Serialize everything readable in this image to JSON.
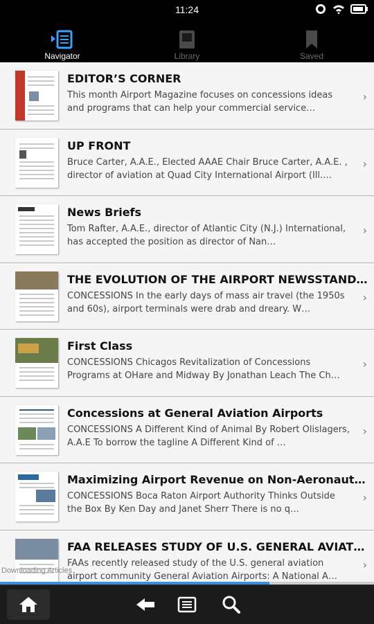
{
  "status": {
    "time": "11:24"
  },
  "tabs": [
    {
      "label": "Navigator",
      "icon": "navigator-icon",
      "active": true
    },
    {
      "label": "Library",
      "icon": "library-icon",
      "active": false
    },
    {
      "label": "Saved",
      "icon": "bookmark-icon",
      "active": false
    }
  ],
  "articles": [
    {
      "title": "EDITOR’S CORNER",
      "desc": "This month Airport Magazine focuses on concessions ideas and programs that can help your commercial service…"
    },
    {
      "title": "UP FRONT",
      "desc": "Bruce Carter, A.A.E., Elected AAAE Chair Bruce Carter, A.A.E. , director of aviation at Quad City International Airport (Ill.…"
    },
    {
      "title": "News Briefs",
      "desc": "Tom Rafter, A.A.E., director of Atlantic City (N.J.) International, has accepted the position as director of Nan…"
    },
    {
      "title": "THE EVOLUTION OF THE AIRPORT NEWSSTAND: I…",
      "desc": "CONCESSIONS In the early days of mass air travel (the 1950s and 60s), airport terminals were drab and dreary. W…"
    },
    {
      "title": "First Class",
      "desc": "CONCESSIONS Chicagos Revitalization of Concessions Programs at OHare and Midway By Jonathan Leach The Ch…"
    },
    {
      "title": "Concessions at General Aviation Airports",
      "desc": "CONCESSIONS A Different Kind of Animal By Robert Olislagers, A.A.E To borrow the tagline A Different Kind of …"
    },
    {
      "title": "Maximizing Airport Revenue on Non-Aeronautic…",
      "desc": "CONCESSIONS Boca Raton Airport Authority Thinks Outside the Box By Ken Day and Janet Sherr There is no q…"
    },
    {
      "title": "FAA RELEASES STUDY OF U.S. GENERAL AVIATION…",
      "desc": "FAAs recently released study of the U.S. general aviation airport community  General Aviation Airports: A National A…"
    }
  ],
  "download": {
    "text": "Downloading Articles",
    "progress": 0.72
  },
  "bottom_nav": [
    "home-icon",
    "back-icon",
    "menu-icon",
    "search-icon"
  ],
  "colors": {
    "progress": "#3d8fdc",
    "background": "#000000",
    "list_bg": "#f5f5f5"
  }
}
